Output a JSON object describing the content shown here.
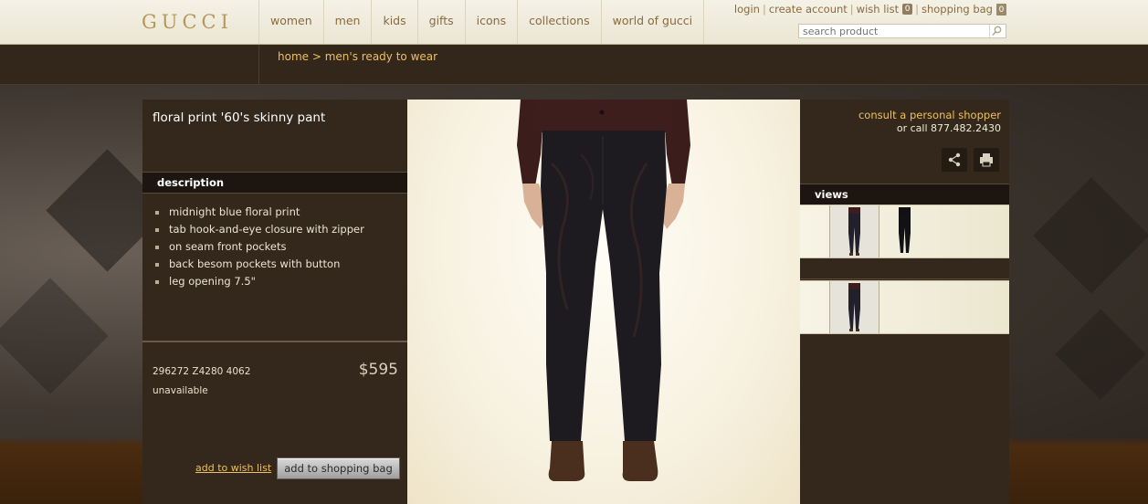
{
  "brand": "GUCCI",
  "nav": [
    "women",
    "men",
    "kids",
    "gifts",
    "icons",
    "collections",
    "world of gucci"
  ],
  "utility": {
    "login": "login",
    "create_account": "create account",
    "wish_list": "wish list",
    "wish_count": "0",
    "shopping_bag": "shopping bag",
    "bag_count": "0",
    "separator": "|"
  },
  "search": {
    "placeholder": "search product"
  },
  "breadcrumb": {
    "home": "home",
    "arrow": " > ",
    "current": "men's ready to wear"
  },
  "product": {
    "title": "floral print '60's skinny pant",
    "description_heading": "description",
    "description": [
      "midnight blue floral print",
      "tab hook-and-eye closure with zipper",
      "on seam front pockets",
      "back besom pockets with button",
      "leg opening 7.5\""
    ],
    "sku": "296272 Z4280 4062",
    "price": "$595",
    "availability": "unavailable",
    "add_to_wish_list": "add to wish list",
    "add_to_bag": "add to shopping bag"
  },
  "sidebar": {
    "consult": "consult a personal shopper",
    "call": "or call 877.482.2430",
    "views_heading": "views",
    "share_icon": "share-icon",
    "print_icon": "print-icon"
  },
  "colors": {
    "accent": "#eec05a",
    "nav_text": "#8a6a3c",
    "panel": "#34281c",
    "header_bg": "#f4f1e6"
  }
}
